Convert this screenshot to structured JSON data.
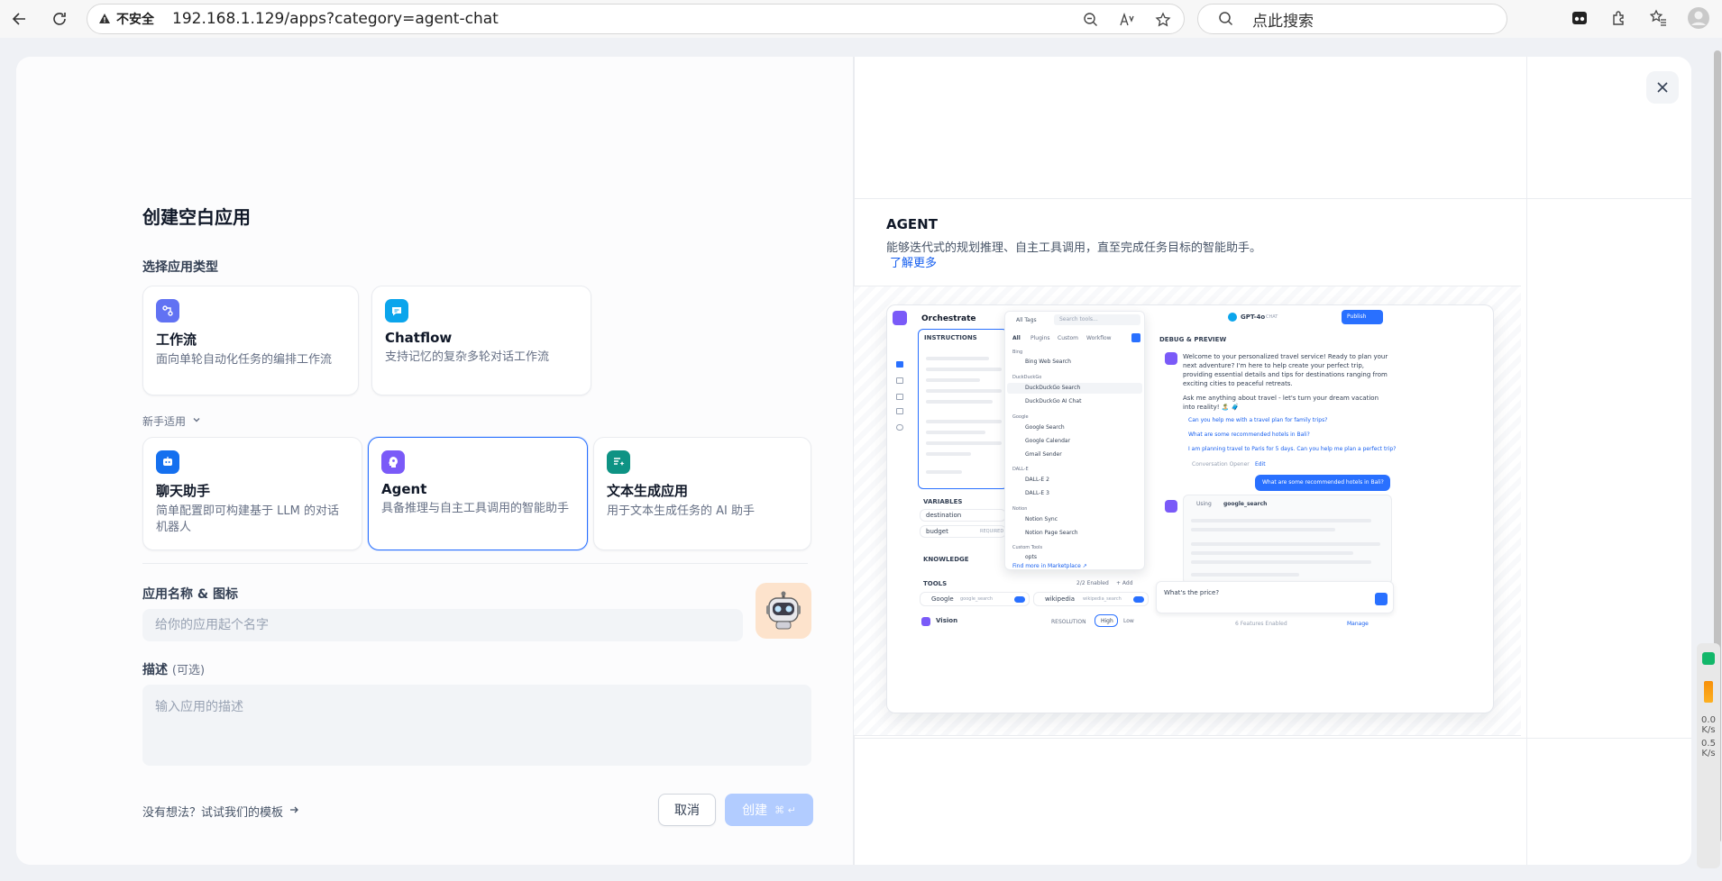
{
  "browser": {
    "security_label": "不安全",
    "url": "192.168.1.129/apps?category=agent-chat",
    "search_placeholder": "点此搜索"
  },
  "modal": {
    "title": "创建空白应用",
    "type_section_label": "选择应用类型",
    "beginner_label": "新手适用",
    "advanced_cards": [
      {
        "title": "工作流",
        "desc": "面向单轮自动化任务的编排工作流"
      },
      {
        "title": "Chatflow",
        "desc": "支持记忆的复杂多轮对话工作流"
      }
    ],
    "beginner_cards": [
      {
        "title": "聊天助手",
        "desc": "简单配置即可构建基于 LLM 的对话机器人"
      },
      {
        "title": "Agent",
        "desc": "具备推理与自主工具调用的智能助手"
      },
      {
        "title": "文本生成应用",
        "desc": "用于文本生成任务的 AI 助手"
      }
    ],
    "name_label": "应用名称 & 图标",
    "name_placeholder": "给你的应用起个名字",
    "desc_label": "描述",
    "desc_optional": "(可选)",
    "desc_placeholder": "输入应用的描述",
    "template_link": "没有想法？试试我们的模板",
    "cancel_label": "取消",
    "create_label": "创建",
    "create_shortcut": "⌘ ↵"
  },
  "preview": {
    "type_title": "AGENT",
    "type_desc": "能够迭代式的规划推理、自主工具调用，直至完成任务目标的智能助手。",
    "learn_more": "了解更多",
    "screenshot": {
      "header": "Orchestrate",
      "instructions": "INSTRUCTIONS",
      "variables": "VARIABLES",
      "var1": "destination",
      "var2": "budget",
      "var2_tag": "REQUIRED",
      "knowledge": "KNOWLEDGE",
      "tools": "TOOLS",
      "tools_enabled": "2/2 Enabled",
      "tools_add": "+ Add",
      "tool1": "Google",
      "tool1_id": "google_search",
      "tool2": "wikipedia",
      "tool2_id": "wikipedia_search",
      "vision": "Vision",
      "resolution": "RESOLUTION",
      "res_high": "High",
      "res_low": "Low",
      "dropdown_tags": "All Tags",
      "dropdown_search": "Search tools...",
      "tabs": [
        "All",
        "Plugins",
        "Custom",
        "Workflow"
      ],
      "groups": [
        {
          "name": "Bing",
          "items": [
            "Bing Web Search"
          ]
        },
        {
          "name": "DuckDuckGo",
          "items": [
            "DuckDuckGo Search",
            "DuckDuckGo AI Chat"
          ]
        },
        {
          "name": "Google",
          "items": [
            "Google Search",
            "Google Calendar",
            "Gmail Sender"
          ]
        },
        {
          "name": "DALL-E",
          "items": [
            "DALL-E 2",
            "DALL-E 3"
          ]
        },
        {
          "name": "Notion",
          "items": [
            "Notion Sync",
            "Notion Page Search"
          ]
        },
        {
          "name": "Custom Tools",
          "items": [
            "opts"
          ]
        }
      ],
      "marketplace": "Find more in Marketplace ↗",
      "model": "GPT-4o",
      "model_tag": "CHAT",
      "publish": "Publish",
      "debug": "DEBUG & PREVIEW",
      "welcome1": "Welcome to your personalized travel service! Ready to plan your next adventure? I'm here to help create your perfect trip, providing essential details and tips for destinations ranging from exciting cities to peaceful retreats.",
      "welcome2": "Ask me anything about travel - let's turn your dream vacation into reality! 🏝️ 🧳",
      "suggest1": "Can you help me with a travel plan for family trips?",
      "suggest2": "What are some recommended hotels in Bali?",
      "suggest3": "I am planning travel to Paris for 5 days. Can you help me plan a perfect trip?",
      "opener": "Conversation Opener",
      "opener_edit": "Edit",
      "user_msg": "What are some recommended hotels in Bali?",
      "using": "Using",
      "using_tool": "google_search",
      "input": "What's the price?",
      "features": "6 Features Enabled",
      "manage": "Manage"
    }
  },
  "sidebar_widget": {
    "v1": "0.0",
    "u1": "K/s",
    "v2": "0.5",
    "u2": "K/s"
  },
  "colors": {
    "accent": "#2970ff",
    "workflow_icon": "#6172f3",
    "chatflow_icon": "#0ba5ec",
    "chat_icon": "#1570ef",
    "agent_icon": "#7a5af8",
    "text_icon": "#0e9384"
  }
}
